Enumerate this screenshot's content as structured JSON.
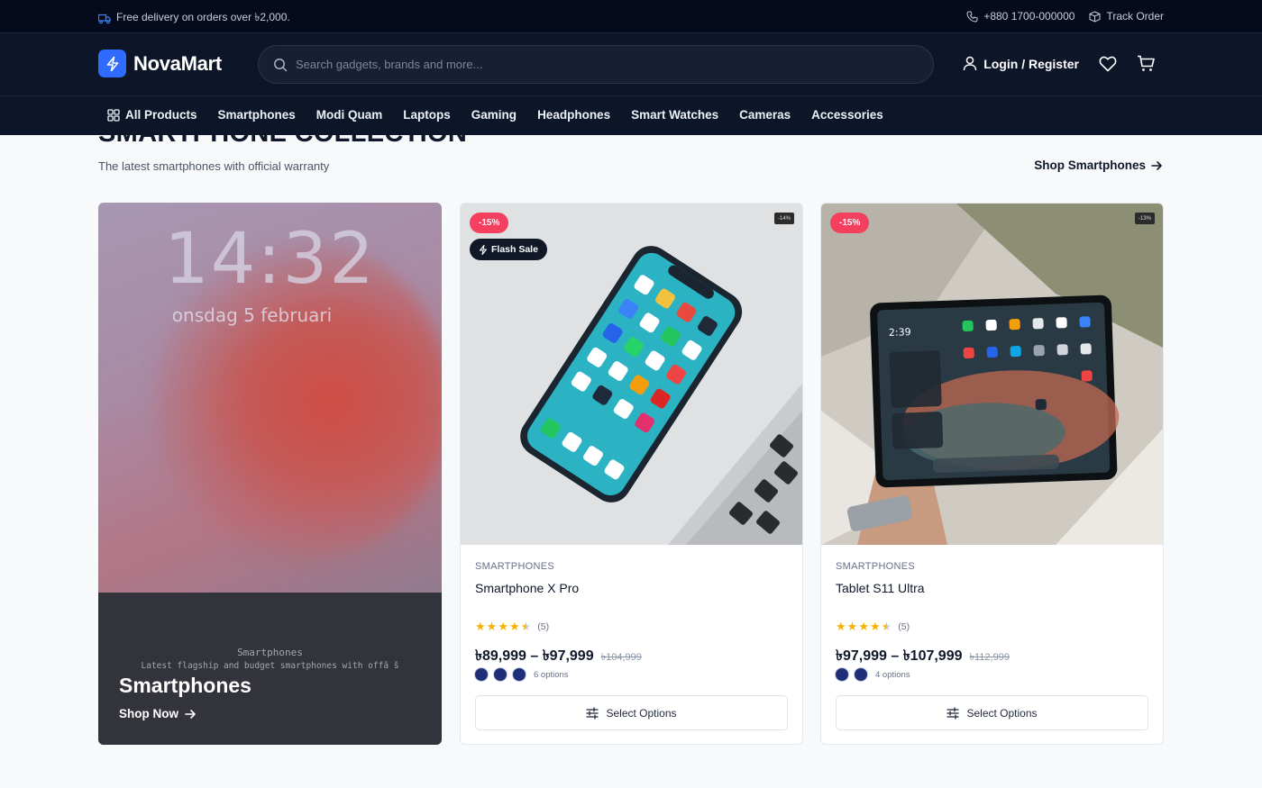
{
  "topbar": {
    "delivery_text": "Free delivery on orders over ৳2,000.",
    "phone": "+880 1700-000000",
    "track_order": "Track Order"
  },
  "header": {
    "brand": "NovaMart",
    "search_placeholder": "Search gadgets, brands and more...",
    "login_label": "Login / Register"
  },
  "nav": {
    "items": [
      "All Products",
      "Smartphones",
      "Modi Quam",
      "Laptops",
      "Gaming",
      "Headphones",
      "Smart Watches",
      "Cameras",
      "Accessories"
    ]
  },
  "section": {
    "title": "SMARTPHONE COLLECTION",
    "subtitle": "The latest smartphones with official warranty",
    "link_label": "Shop Smartphones"
  },
  "promo": {
    "clock": "14:32",
    "date": "onsdag 5 februari",
    "small_title": "Smartphones",
    "small_subtitle": "Latest flagship and budget smartphones with offâ š",
    "title": "Smartphones",
    "cta": "Shop Now"
  },
  "products": [
    {
      "discount": "-15%",
      "flash": "Flash Sale",
      "tiny_badge": "-14%",
      "category": "SMARTPHONES",
      "name": "Smartphone X Pro",
      "rating": 4.5,
      "rating_count": "(5)",
      "price": "৳89,999 – ৳97,999",
      "old_price": "৳104,999",
      "swatches": 3,
      "options_label": "6 options",
      "button": "Select Options"
    },
    {
      "discount": "-15%",
      "tiny_badge": "-13%",
      "category": "SMARTPHONES",
      "name": "Tablet S11 Ultra",
      "rating": 4.5,
      "rating_count": "(5)",
      "price": "৳97,999 – ৳107,999",
      "old_price": "৳112,999",
      "swatches": 2,
      "options_label": "4 options",
      "button": "Select Options"
    }
  ],
  "colors": {
    "dark_bg": "#0d1528",
    "topbar_bg": "#050b1c",
    "brand_blue": "#2f6bff",
    "discount": "#f43f5e",
    "star": "#f5b301"
  }
}
